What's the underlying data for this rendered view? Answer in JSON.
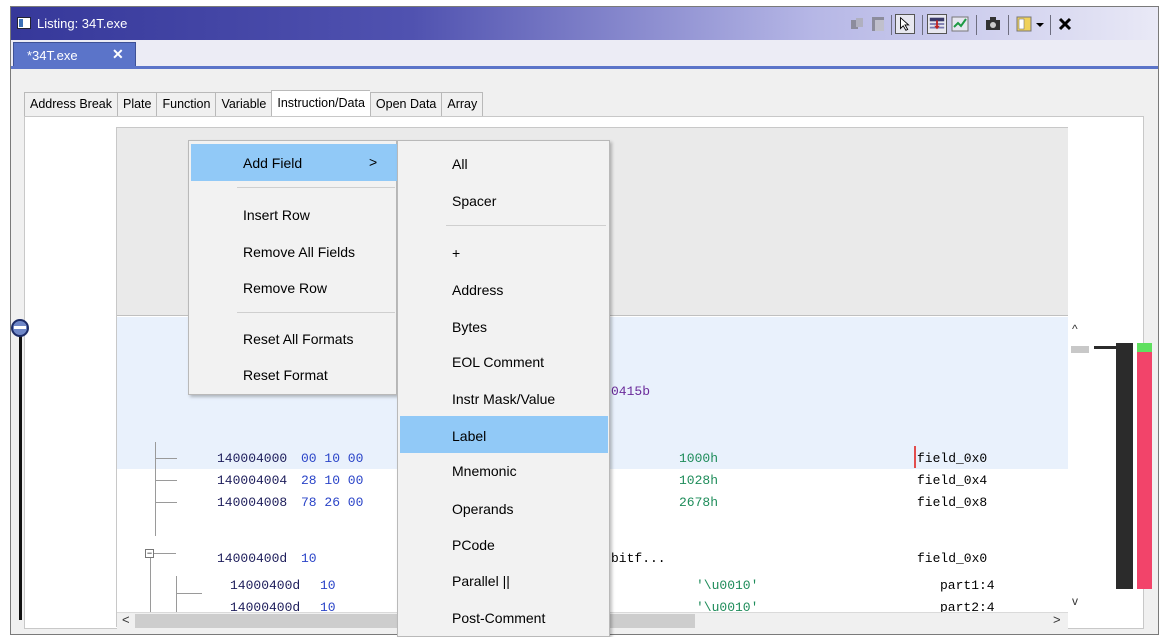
{
  "window": {
    "title": "Listing: 34T.exe"
  },
  "file_tab": {
    "label": "*34T.exe",
    "close_glyph": "✕"
  },
  "format_tabs": [
    "Address Break",
    "Plate",
    "Function",
    "Variable",
    "Instruction/Data",
    "Open Data",
    "Array"
  ],
  "active_format_tab": "Instruction/Data",
  "toolbar_icons": [
    "copy-icon",
    "paste-icon",
    "cursor-select-icon",
    "field-header-icon",
    "diff-icon",
    "snapshot-icon",
    "view-options-icon",
    "dropdown-icon",
    "close-icon"
  ],
  "context_menu": {
    "items": [
      "Add Field",
      "Insert Row",
      "Remove All Fields",
      "Remove Row",
      "Reset All Formats",
      "Reset Format"
    ],
    "add_field_arrow": ">"
  },
  "submenu": {
    "items": [
      "All",
      "Spacer",
      "+",
      "Address",
      "Bytes",
      "EOL Comment",
      "Instr Mask/Value",
      "Label",
      "Mnemonic",
      "Operands",
      "PCode",
      "Parallel ||",
      "Post-Comment"
    ],
    "highlighted": "Label"
  },
  "listing": {
    "header_fragment": "0415b",
    "rows": [
      {
        "address": "140004000",
        "bytes": "00 10 00",
        "operand": "1000h",
        "field": "field_0x0"
      },
      {
        "address": "140004004",
        "bytes": "28 10 00",
        "operand": "1028h",
        "field": "field_0x4"
      },
      {
        "address": "140004008",
        "bytes": "78 26 00",
        "operand": "2678h",
        "field": "field_0x8"
      },
      {
        "address": "14000400d",
        "bytes": "10",
        "operand": "bitf...",
        "field": "field_0x0"
      },
      {
        "address": "14000400d",
        "bytes": "10",
        "operand": "'\\u0010'",
        "field": "part1:4"
      },
      {
        "address": "14000400d",
        "bytes": "10",
        "operand": "'\\u0010'",
        "field": "part2:4"
      }
    ]
  },
  "scroll": {
    "up": "^",
    "down": "v",
    "left": "<",
    "right": ">"
  },
  "colors": {
    "title_gradient_start": "#36389a",
    "tab_active": "#5b74c9",
    "menu_highlight": "#91c9f7",
    "selection": "#e9f1fc"
  }
}
